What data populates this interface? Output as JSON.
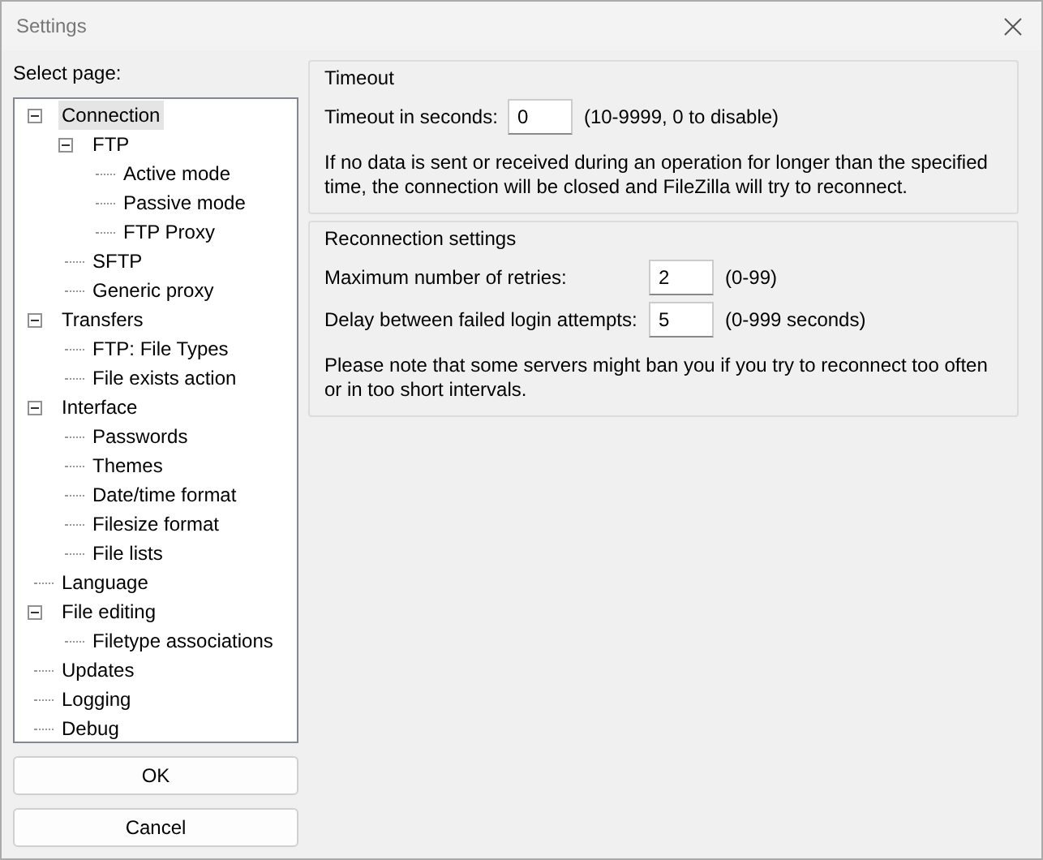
{
  "window": {
    "title": "Settings"
  },
  "sidebar": {
    "label": "Select page:",
    "items": [
      {
        "label": "Connection",
        "selected": true,
        "expanded": true,
        "children": [
          {
            "label": "FTP",
            "selected": false,
            "expanded": true,
            "children": [
              {
                "label": "Active mode",
                "selected": false
              },
              {
                "label": "Passive mode",
                "selected": false
              },
              {
                "label": "FTP Proxy",
                "selected": false
              }
            ]
          },
          {
            "label": "SFTP",
            "selected": false
          },
          {
            "label": "Generic proxy",
            "selected": false
          }
        ]
      },
      {
        "label": "Transfers",
        "selected": false,
        "expanded": true,
        "children": [
          {
            "label": "FTP: File Types",
            "selected": false
          },
          {
            "label": "File exists action",
            "selected": false
          }
        ]
      },
      {
        "label": "Interface",
        "selected": false,
        "expanded": true,
        "children": [
          {
            "label": "Passwords",
            "selected": false
          },
          {
            "label": "Themes",
            "selected": false
          },
          {
            "label": "Date/time format",
            "selected": false
          },
          {
            "label": "Filesize format",
            "selected": false
          },
          {
            "label": "File lists",
            "selected": false
          }
        ]
      },
      {
        "label": "Language",
        "selected": false
      },
      {
        "label": "File editing",
        "selected": false,
        "expanded": true,
        "children": [
          {
            "label": "Filetype associations",
            "selected": false
          }
        ]
      },
      {
        "label": "Updates",
        "selected": false
      },
      {
        "label": "Logging",
        "selected": false
      },
      {
        "label": "Debug",
        "selected": false
      }
    ]
  },
  "buttons": [
    "OK",
    "Cancel"
  ],
  "groups": [
    {
      "title": "Timeout",
      "fields": [
        {
          "label": "Timeout in seconds:",
          "value": "0",
          "hint": "(10-9999, 0 to disable)"
        }
      ],
      "note": "If no data is sent or received during an operation for longer than the specified time, the connection will be closed and FileZilla will try to reconnect."
    },
    {
      "title": "Reconnection settings",
      "fields": [
        {
          "label": "Maximum number of retries:",
          "value": "2",
          "hint": "(0-99)"
        },
        {
          "label": "Delay between failed login attempts:",
          "value": "5",
          "hint": "(0-999 seconds)"
        }
      ],
      "note": "Please note that some servers might ban you if you try to reconnect too often or in too short intervals."
    }
  ]
}
